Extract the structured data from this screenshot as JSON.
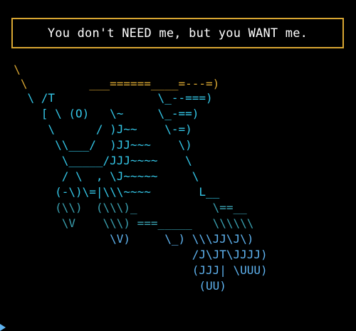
{
  "speech": {
    "text": "You don't NEED me, but you WANT me."
  },
  "art_lines": [
    "  \\",
    "   \\         ___======____=---=)",
    "    \\ /T               \\_--===)",
    "      [ \\ (O)   \\~     \\_-==)",
    "       \\      / )J~~    \\-=)",
    "        \\\\___/  )JJ~~~    \\)",
    "         \\_____/JJJ~~~~    \\",
    "         / \\  , \\J~~~~~     \\",
    "        (-\\)\\=|\\\\\\~~~~       L__",
    "        (\\\\)  (\\\\\\)_           \\==__",
    "         \\V    \\\\\\) ===_____   \\\\\\\\\\\\",
    "                \\V)     \\_) \\\\\\JJ\\J\\)",
    "                            /J\\JT\\JJJJ)",
    "                            (JJJ| \\UUU)",
    "                             (UU)"
  ],
  "colors": {
    "background": "#000000",
    "border": "#d8a632",
    "speech_text": "#ffffff",
    "art_gold": "#d8a632",
    "art_cyan": "#34c7e8",
    "art_teal": "#3aa0b0",
    "art_blue": "#5fb3f0"
  },
  "icons": {
    "cursor": "prompt-arrow-icon"
  }
}
